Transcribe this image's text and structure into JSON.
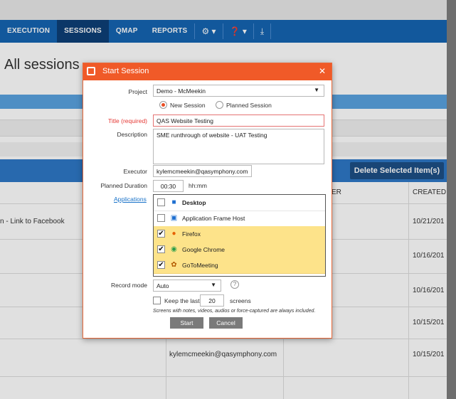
{
  "nav": {
    "items": [
      {
        "label": "EXECUTION",
        "active": false
      },
      {
        "label": "SESSIONS",
        "active": true
      },
      {
        "label": "QMAP",
        "active": false
      },
      {
        "label": "REPORTS",
        "active": false
      }
    ],
    "icons": [
      "gear-icon",
      "help-icon",
      "download-icon"
    ]
  },
  "page": {
    "title": "All sessions"
  },
  "toolbar": {
    "delete_label": "Delete Selected Item(s)"
  },
  "table": {
    "col_partial_er": "ER",
    "col_created": "CREATED",
    "rows": [
      {
        "name": "n - Link to Facebook",
        "executor": "",
        "created": "10/21/201"
      },
      {
        "name": "",
        "executor": "",
        "created": "10/16/201"
      },
      {
        "name": "",
        "executor": "",
        "created": "10/16/201"
      },
      {
        "name": "",
        "executor": "",
        "created": "10/15/201"
      },
      {
        "name": "",
        "executor": "kylemcmeekin@qasymphony.com",
        "created": "10/15/201"
      }
    ]
  },
  "dialog": {
    "title": "Start Session",
    "project_label": "Project",
    "project_value": "Demo - McMeekin",
    "new_session_label": "New Session",
    "planned_session_label": "Planned Session",
    "title_label": "Title (required)",
    "title_value": "QAS Website Testing",
    "description_label": "Description",
    "description_value": "SME runthrough of website - UAT Testing",
    "executor_label": "Executor",
    "executor_value": "kylemcmeekin@qasymphony.com",
    "duration_label": "Planned Duration",
    "duration_value": "00:30",
    "duration_unit": "hh:mm",
    "applications_label": "Applications",
    "apps": [
      {
        "name": "Desktop",
        "checked": false,
        "selected": false,
        "icon": "desktop-icon"
      },
      {
        "name": "Application Frame Host",
        "checked": false,
        "selected": false,
        "icon": "window-icon"
      },
      {
        "name": "Firefox",
        "checked": true,
        "selected": true,
        "icon": "firefox-icon"
      },
      {
        "name": "Google Chrome",
        "checked": true,
        "selected": true,
        "icon": "chrome-icon"
      },
      {
        "name": "GoToMeeting",
        "checked": true,
        "selected": true,
        "icon": "gotomeeting-icon"
      }
    ],
    "record_mode_label": "Record mode",
    "record_mode_value": "Auto",
    "keep_last_label": "Keep the last",
    "keep_last_value": "20",
    "screens_label": "screens",
    "note": "Screens with notes, videos, audios or force-captured are always included.",
    "start_label": "Start",
    "cancel_label": "Cancel"
  }
}
